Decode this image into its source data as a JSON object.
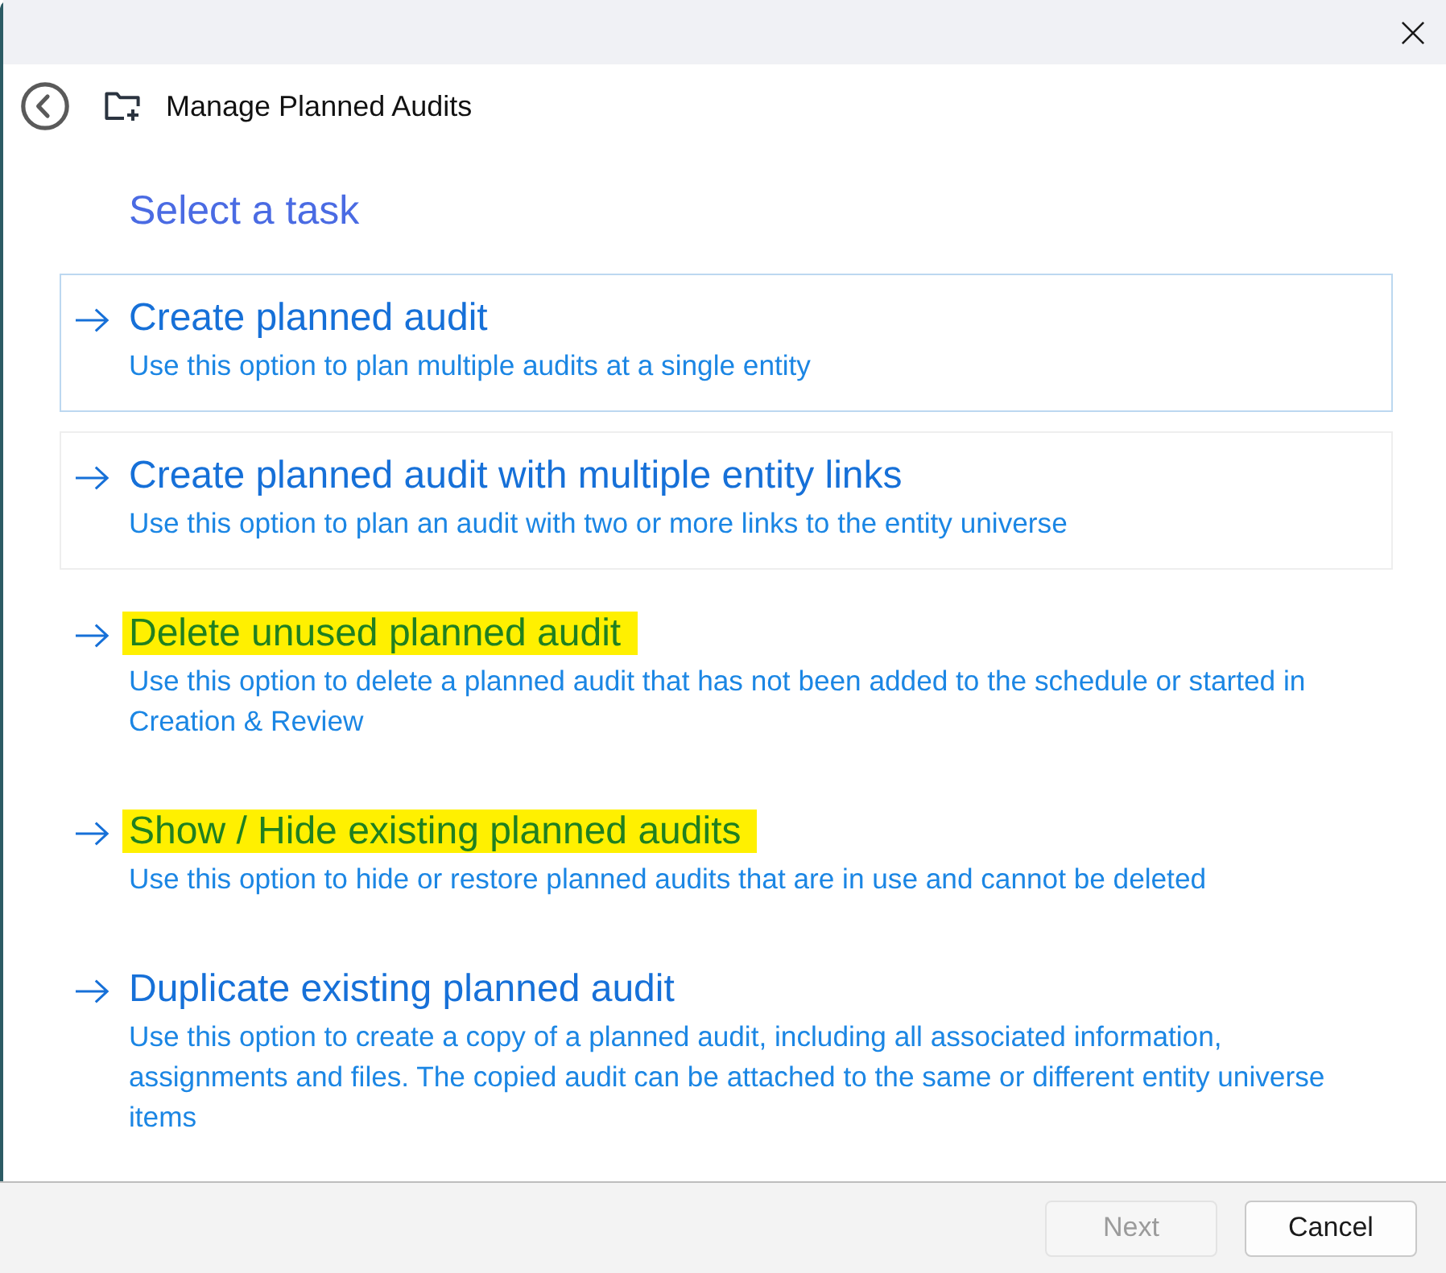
{
  "header": {
    "title": "Manage Planned Audits"
  },
  "heading": "Select a task",
  "options": [
    {
      "title": "Create planned audit",
      "description": "Use this option to plan multiple audits at a single entity",
      "selected": true,
      "hovered": false,
      "highlighted": false
    },
    {
      "title": "Create planned audit with multiple entity links",
      "description": "Use this option to plan an audit with two or more links to the entity universe",
      "selected": false,
      "hovered": true,
      "highlighted": false
    },
    {
      "title": "Delete unused planned audit",
      "description": "Use this option to delete a planned audit that has not been added to the schedule or started in Creation & Review",
      "selected": false,
      "hovered": false,
      "highlighted": true
    },
    {
      "title": "Show / Hide existing planned audits",
      "description": "Use this option to hide or restore planned audits that are in use and cannot be deleted",
      "selected": false,
      "hovered": false,
      "highlighted": true
    },
    {
      "title": "Duplicate existing planned audit",
      "description": "Use this option to create a copy of a planned audit, including all associated information, assignments and files. The copied audit can be attached to the same or different entity universe items",
      "selected": false,
      "hovered": false,
      "highlighted": false
    }
  ],
  "footer": {
    "buttons": [
      {
        "label": "Next",
        "disabled": true
      },
      {
        "label": "Cancel",
        "disabled": false
      }
    ]
  }
}
